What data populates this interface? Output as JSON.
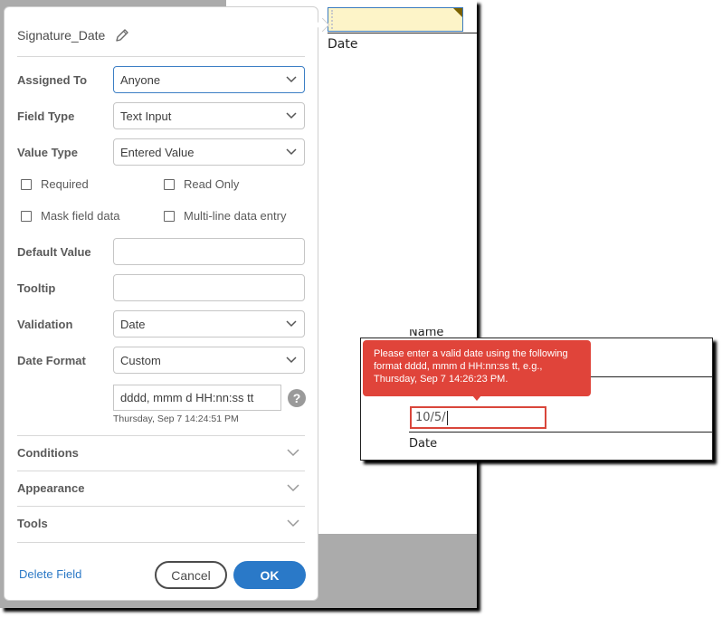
{
  "document": {
    "date_label": "Date"
  },
  "dialog": {
    "title": "Signature_Date",
    "fields": {
      "assigned_to": {
        "label": "Assigned To",
        "value": "Anyone"
      },
      "field_type": {
        "label": "Field Type",
        "value": "Text Input"
      },
      "value_type": {
        "label": "Value Type",
        "value": "Entered Value"
      },
      "default_value": {
        "label": "Default Value",
        "value": ""
      },
      "tooltip": {
        "label": "Tooltip",
        "value": ""
      },
      "validation": {
        "label": "Validation",
        "value": "Date"
      },
      "date_format": {
        "label": "Date Format",
        "value": "Custom"
      }
    },
    "checkboxes": [
      {
        "label": "Required",
        "checked": false
      },
      {
        "label": "Read Only",
        "checked": false
      },
      {
        "label": "Mask field data",
        "checked": false
      },
      {
        "label": "Multi-line data entry",
        "checked": false
      }
    ],
    "custom_format": {
      "value": "dddd, mmm d  HH:nn:ss tt",
      "preview": "Thursday, Sep 7 14:24:51 PM",
      "help": "?"
    },
    "sections": [
      {
        "label": "Conditions"
      },
      {
        "label": "Appearance"
      },
      {
        "label": "Tools"
      }
    ],
    "footer": {
      "delete_label": "Delete Field",
      "cancel_label": "Cancel",
      "ok_label": "OK"
    }
  },
  "validation_example": {
    "name_label": "Name",
    "tooltip_text": "Please enter a valid date using the following format dddd, mmm d HH:nn:ss tt, e.g., Thursday, Sep 7 14:26:23 PM.",
    "input_value": "10/5/",
    "date_label": "Date"
  },
  "colors": {
    "accent": "#2a79c8",
    "error": "#e0443a",
    "field_highlight": "#fdf4c8"
  }
}
